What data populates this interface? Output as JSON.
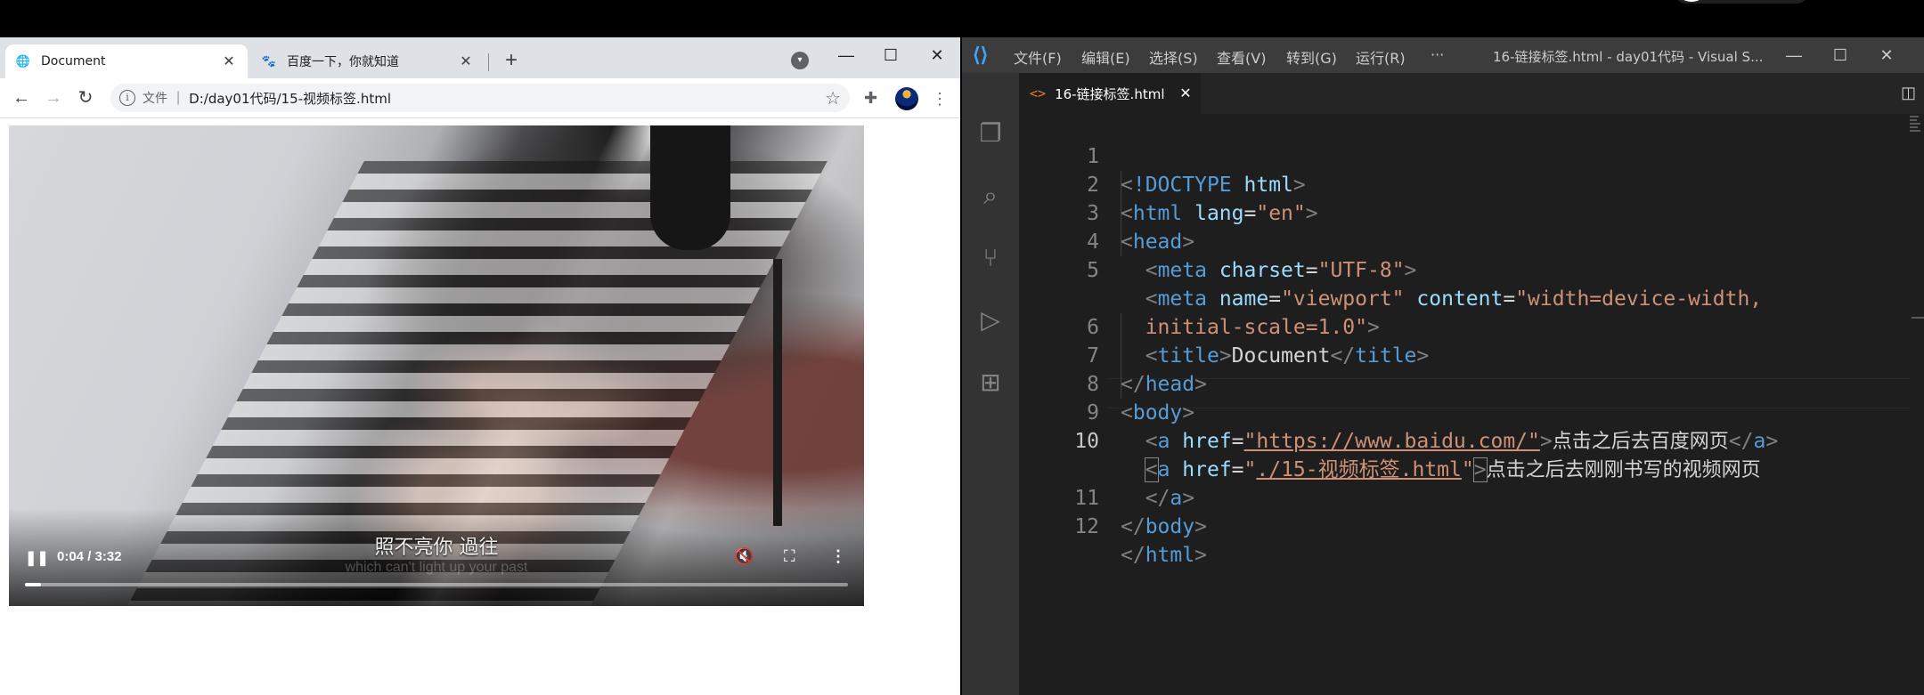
{
  "browser": {
    "tabs": [
      {
        "title": "Document",
        "icon": "globe-icon",
        "active": true
      },
      {
        "title": "百度一下，你就知道",
        "icon": "baidu-paw-icon",
        "active": false
      }
    ],
    "new_tab": "+",
    "window_controls": {
      "minimize": "—",
      "maximize": "☐",
      "close": "✕"
    },
    "address": {
      "scheme_label": "文件",
      "url": "D:/day01代码/15-视频标签.html"
    },
    "video": {
      "subtitle_cn": "照不亮你 過往",
      "subtitle_en": "which can't light up your past",
      "time": "0:04 / 3:32",
      "progress_fraction": 0.019,
      "muted": true
    }
  },
  "vscode": {
    "menu": [
      "文件(F)",
      "编辑(E)",
      "选择(S)",
      "查看(V)",
      "转到(G)",
      "运行(R)",
      "···"
    ],
    "window_title": "16-链接标签.html - day01代码 - Visual S...",
    "window_controls": {
      "minimize": "—",
      "maximize": "☐",
      "close": "✕"
    },
    "tab": {
      "title": "16-链接标签.html",
      "close": "✕"
    },
    "line_numbers": [
      "1",
      "2",
      "3",
      "4",
      "5",
      "",
      "6",
      "7",
      "8",
      "9",
      "10",
      "",
      "11",
      "12"
    ],
    "code": {
      "l1_tag": "!DOCTYPE",
      "l1_attr": "html",
      "l2_tag": "html",
      "l2_attr": "lang",
      "l2_val": "\"en\"",
      "l3_tag": "head",
      "l4_tag": "meta",
      "l4_attr": "charset",
      "l4_val": "\"UTF-8\"",
      "l5_tag": "meta",
      "l5_attr1": "name",
      "l5_val1": "\"viewport\"",
      "l5_attr2": "content",
      "l5_val2a": "\"width=device-width,",
      "l5_val2b": "initial-scale=1.0\"",
      "l6_tag": "title",
      "l6_text": "Document",
      "l6_close": "title",
      "l7_tag": "head",
      "l8_tag": "body",
      "l9_tag": "a",
      "l9_attr": "href",
      "l9_val": "\"https://www.baidu.com/\"",
      "l9_text": "点击之后去百度网页",
      "l9_close": "a",
      "l10_tag": "a",
      "l10_attr": "href",
      "l10_val_q1": "\"",
      "l10_val": "./15-视频标签.html",
      "l10_val_q2": "\"",
      "l10_text": "点击之后去刚刚书写的视频网页",
      "l10b_close": "a",
      "l11_tag": "body",
      "l12_tag": "html"
    }
  }
}
